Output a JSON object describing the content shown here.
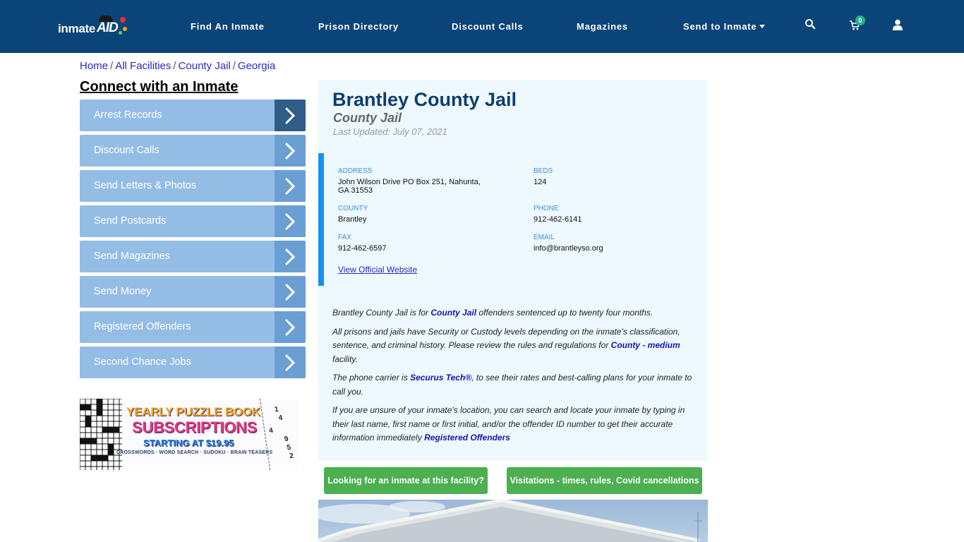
{
  "header": {
    "logo": {
      "text": "inmate",
      "accent": "AID"
    },
    "nav": [
      {
        "label": "Find An Inmate"
      },
      {
        "label": "Prison Directory"
      },
      {
        "label": "Discount Calls"
      },
      {
        "label": "Magazines"
      },
      {
        "label": "Send to Inmate",
        "has_dropdown": true
      }
    ],
    "icons": {
      "search": "search-icon",
      "cart": "cart-icon",
      "user": "user-icon"
    },
    "cart_count": "0"
  },
  "breadcrumb": [
    {
      "label": "Home"
    },
    {
      "label": "All Facilities"
    },
    {
      "label": "County Jail"
    },
    {
      "label": "Georgia"
    }
  ],
  "breadcrumb_separator": "/",
  "sidebar": {
    "title": "Connect with an Inmate",
    "items": [
      {
        "label": "Arrest Records"
      },
      {
        "label": "Discount Calls"
      },
      {
        "label": "Send Letters & Photos"
      },
      {
        "label": "Send Postcards"
      },
      {
        "label": "Send Magazines"
      },
      {
        "label": "Send Money"
      },
      {
        "label": "Registered Offenders"
      },
      {
        "label": "Second Chance Jobs"
      }
    ],
    "ad": {
      "line1": "YEARLY PUZZLE BOOK",
      "line2": "SUBSCRIPTIONS",
      "line3": "STARTING AT $19.95",
      "line4": "CROSSWORDS · WORD SEARCH · SUDOKU · BRAIN TEASERS",
      "sudoku_digits": [
        "1",
        "4",
        "4",
        "9",
        "5",
        "2"
      ]
    }
  },
  "facility": {
    "name": "Brantley County Jail",
    "type": "County Jail",
    "last_updated": "Last Updated: July 07, 2021",
    "address_label": "ADDRESS",
    "address": "John Wilson Drive PO Box 251, Nahunta,",
    "address_line2": "GA 31553",
    "beds_label": "BEDS",
    "beds": "124",
    "county_label": "COUNTY",
    "county": "Brantley",
    "phone_label": "PHONE",
    "phone": "912-462-6141",
    "fax_label": "FAX",
    "fax": "912-462-6597",
    "email_label": "EMAIL",
    "email": "info@brantleyso.org",
    "website_link": "View Official Website"
  },
  "description": {
    "p1_a": "Brantley County Jail is for ",
    "p1_link": "County Jail",
    "p1_b": " offenders sentenced up to twenty four months.",
    "p2_a": "All prisons and jails have Security or Custody levels depending on the inmate's classification, sentence, and criminal history. Please review the rules and regulations for ",
    "p2_link": "County - medium",
    "p2_b": " facility.",
    "p3_a": "The phone carrier is ",
    "p3_link": "Securus Tech®",
    "p3_b": ", to see their rates and best-calling plans for your inmate to call you.",
    "p4_a": "If you are unsure of your inmate's location, you can search and locate your inmate by typing in their last name, first name or first initial, and/or the offender ID number to get their accurate information immediately ",
    "p4_link": "Registered Offenders"
  },
  "buttons": {
    "find_inmate": "Looking for an inmate at this facility?",
    "visitations": "Visitations - times, rules, Covid cancellations"
  },
  "colors": {
    "header_bg": "#0b4479",
    "sidebar_item": "#94bde6",
    "sidebar_arrow": "#6a9fd3",
    "sidebar_arrow_active": "#305c89",
    "card_bg": "#edf8ff",
    "accent_bar": "#1592f1",
    "button_green": "#4caf50",
    "title": "#0d3f6e"
  }
}
